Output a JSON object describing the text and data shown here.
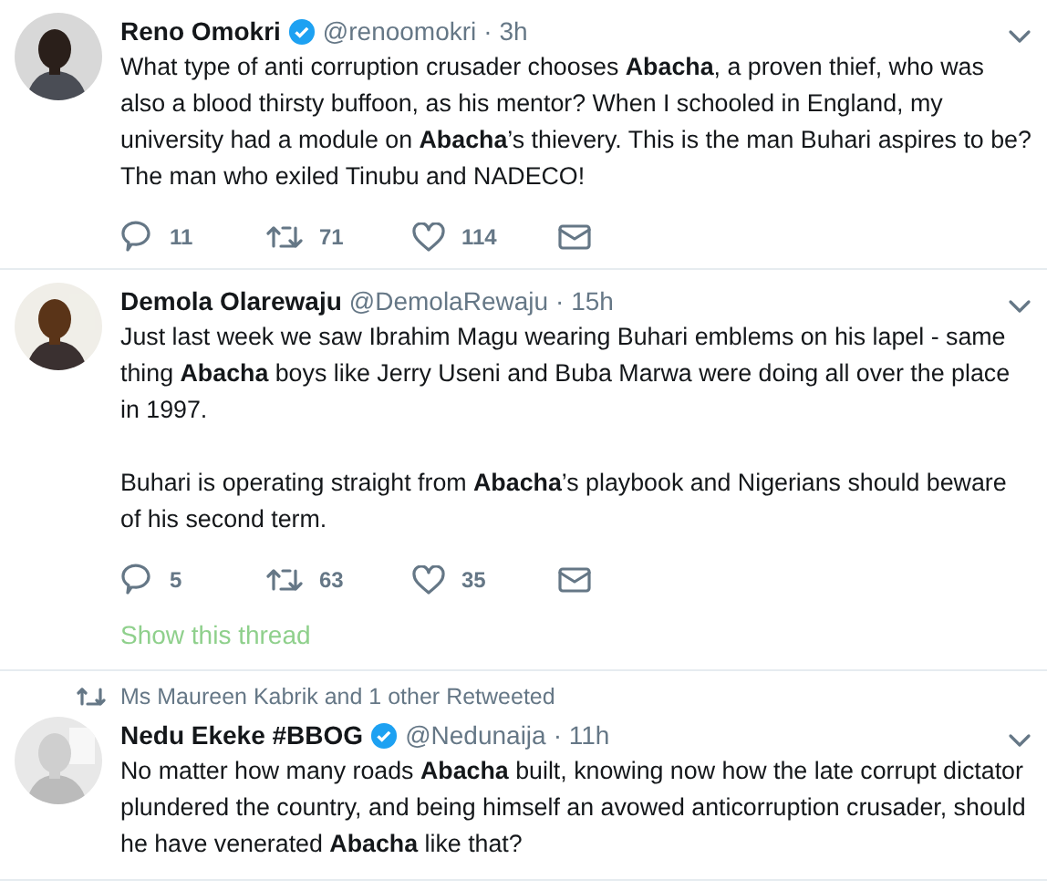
{
  "tweets": [
    {
      "name": "Reno Omokri",
      "verified": true,
      "handle": "@renoomokri",
      "time": "· 3h",
      "paragraphs": [
        "What type of anti corruption crusader chooses **Abacha**, a proven thief, who was also a blood thirsty buffoon, as his mentor? When I schooled in England, my university had a module on **Abacha**’s thievery. This is the man Buhari aspires to be? The man who exiled Tinubu and NADECO!"
      ],
      "replies": "11",
      "retweets": "71",
      "likes": "114"
    },
    {
      "name": "Demola Olarewaju",
      "verified": false,
      "handle": "@DemolaRewaju",
      "time": "· 15h",
      "paragraphs": [
        "Just last week we saw Ibrahim Magu wearing Buhari emblems on his lapel - same thing **Abacha** boys like Jerry Useni and Buba Marwa were doing all over the place in 1997.",
        "Buhari is operating straight from **Abacha**’s playbook and Nigerians should beware of his second term."
      ],
      "replies": "5",
      "retweets": "63",
      "likes": "35",
      "show_thread": "Show this thread"
    },
    {
      "retweeted_by": "Ms Maureen Kabrik and 1 other Retweeted",
      "name": "Nedu Ekeke #BBOG",
      "verified": true,
      "handle": "@Nedunaija",
      "time": "· 11h",
      "paragraphs": [
        "No matter how many roads **Abacha** built, knowing now how the late corrupt dictator plundered the country, and being himself an avowed anticorruption crusader, should he have venerated **Abacha** like that?"
      ]
    }
  ]
}
